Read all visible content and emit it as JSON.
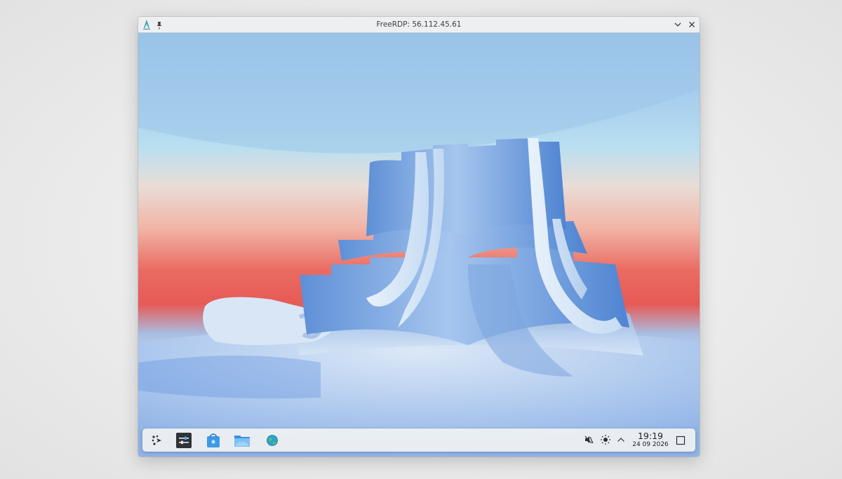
{
  "window": {
    "title": "FreeRDP: 56.112.45.61",
    "icons": {
      "app": "freerdp-app-icon",
      "pin": "pin-icon",
      "minimize": "chevron-down-icon",
      "close": "close-icon"
    }
  },
  "taskbar": {
    "launchers": [
      {
        "name": "application-launcher",
        "icon": "kde-launcher-icon"
      },
      {
        "name": "system-settings",
        "icon": "settings-sliders-icon"
      },
      {
        "name": "discover-store",
        "icon": "store-bag-icon"
      },
      {
        "name": "file-manager",
        "icon": "folder-icon"
      },
      {
        "name": "web-browser",
        "icon": "globe-icon"
      }
    ],
    "tray": [
      {
        "name": "volume-muted",
        "icon": "speaker-muted-icon"
      },
      {
        "name": "brightness",
        "icon": "sun-icon"
      },
      {
        "name": "show-hidden-icons",
        "icon": "chevron-up-icon"
      }
    ],
    "clock": {
      "time": "19:19",
      "date": "24 09 2026"
    },
    "show_desktop_icon": "show-desktop-icon"
  },
  "colors": {
    "accent": "#3d8fe0",
    "sky_top": "#9cc3e8",
    "glow_red": "#e85b56",
    "titlebar": "#eeeff1",
    "taskbar": "#eceff3"
  }
}
